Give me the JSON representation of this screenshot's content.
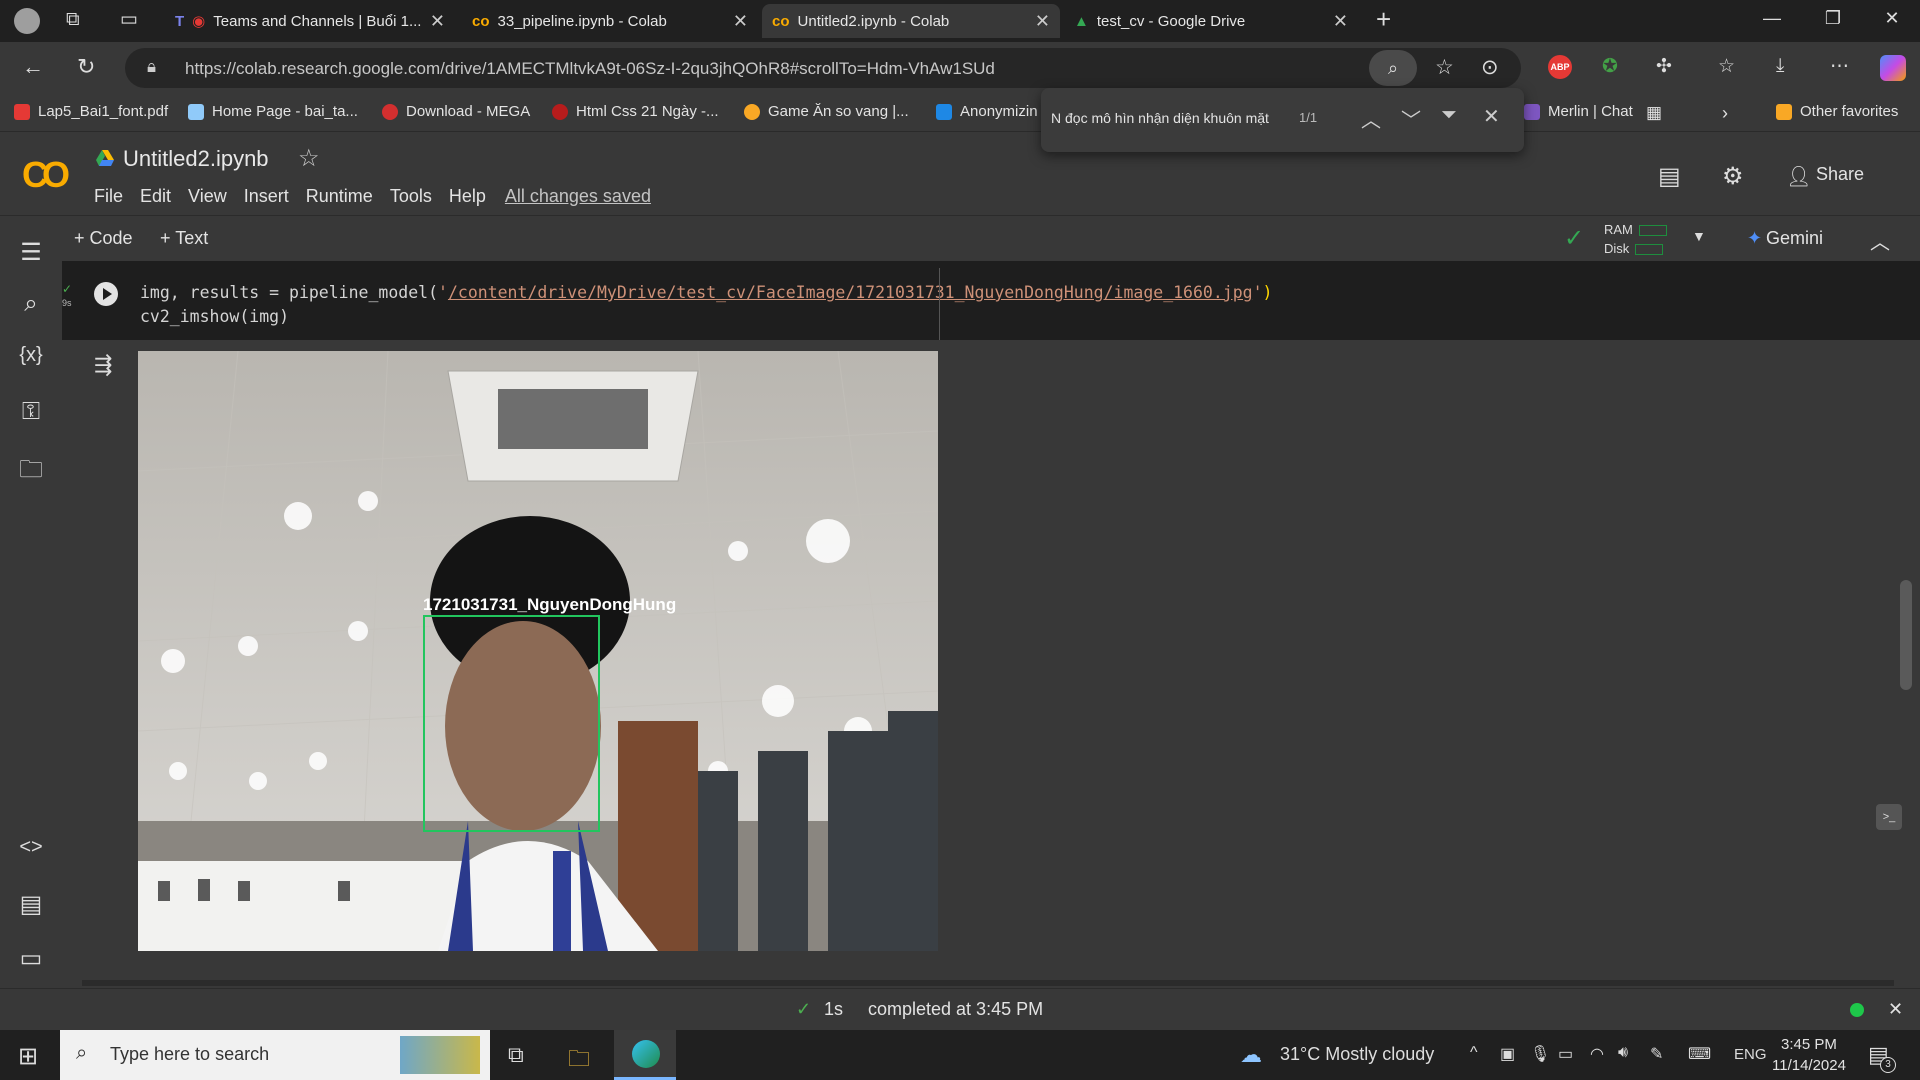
{
  "browser": {
    "tabs": [
      {
        "label": "Teams and Channels | Buổi 1..."
      },
      {
        "label": "33_pipeline.ipynb - Colab"
      },
      {
        "label": "Untitled2.ipynb - Colab"
      },
      {
        "label": "test_cv - Google Drive"
      }
    ],
    "url": "https://colab.research.google.com/drive/1AMECTMltvkA9t-06Sz-I-2qu3jhQOhR8#scrollTo=Hdm-VhAw1SUd",
    "bookmarks": [
      {
        "label": "Lap5_Bai1_font.pdf",
        "color": "#e53935"
      },
      {
        "label": "Home Page - bai_ta...",
        "color": "#90caf9"
      },
      {
        "label": "Download - MEGA",
        "color": "#d32f2f"
      },
      {
        "label": "Html Css 21 Ngày -...",
        "color": "#b71c1c"
      },
      {
        "label": "Game Ăn so vang |...",
        "color": "#f9a825"
      },
      {
        "label": "Anonymizin",
        "color": "#1e88e5"
      },
      {
        "label": "Merlin | Chat",
        "color": "#7e57c2"
      },
      {
        "label": "Other favorites",
        "color": "#f9a825"
      }
    ],
    "find_bar": {
      "query": "N đọc mô hìn nhận diện khuôn mặt",
      "count": "1/1"
    }
  },
  "colab": {
    "title": "Untitled2.ipynb",
    "menu": [
      "File",
      "Edit",
      "View",
      "Insert",
      "Runtime",
      "Tools",
      "Help"
    ],
    "saved_status": "All changes saved",
    "share_label": "Share",
    "add_code": "+ Code",
    "add_text": "+ Text",
    "ram_label": "RAM",
    "disk_label": "Disk",
    "gemini_label": "Gemini",
    "cell": {
      "exec_time": "9s",
      "line1_a": "img, results = pipeline_model(",
      "line1_q1": "'",
      "line1_path": "/content/drive/MyDrive/test_cv/FaceImage/1721031731_NguyenDongHung/image_1660.jpg",
      "line1_q2": "'",
      "line1_close": ")",
      "line2": "cv2_imshow(img)"
    },
    "output": {
      "face_label": "1721031731_NguyenDongHung"
    },
    "status": {
      "duration": "1s",
      "completed": "completed at 3:45 PM"
    }
  },
  "taskbar": {
    "search_placeholder": "Type here to search",
    "weather": "31°C  Mostly cloudy",
    "lang": "ENG",
    "time": "3:45 PM",
    "date": "11/14/2024",
    "notif_count": "3"
  }
}
